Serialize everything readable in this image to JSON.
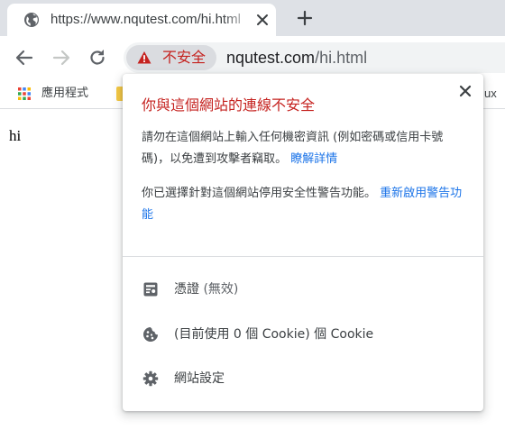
{
  "tab": {
    "title": "https://www.nqutest.com/hi.html"
  },
  "omnibox": {
    "security_label": "不安全",
    "url_host": "nqutest.com",
    "url_path": "/hi.html"
  },
  "bookmarks": {
    "apps_label": "應用程式",
    "overflow_fragment": "ux"
  },
  "page": {
    "text": "hi"
  },
  "popup": {
    "title": "你與這個網站的連線不安全",
    "para1_text": "請勿在這個網站上輸入任何機密資訊 (例如密碼或信用卡號碼)，以免遭到攻擊者竊取。",
    "para1_link": "瞭解詳情",
    "para2_text": "你已選擇針對這個網站停用安全性警告功能。",
    "para2_link": "重新啟用警告功能",
    "rows": [
      {
        "label": "憑證",
        "sub": "(無效)",
        "icon": "certificate-icon"
      },
      {
        "label": "(目前使用 0 個 Cookie) 個 Cookie",
        "sub": "",
        "icon": "cookie-icon"
      },
      {
        "label": "網站設定",
        "sub": "",
        "icon": "gear-icon"
      }
    ]
  },
  "colors": {
    "danger": "#c5221f",
    "link": "#1a73e8",
    "tabstrip": "#dee1e6",
    "omnibox": "#f1f3f4"
  }
}
